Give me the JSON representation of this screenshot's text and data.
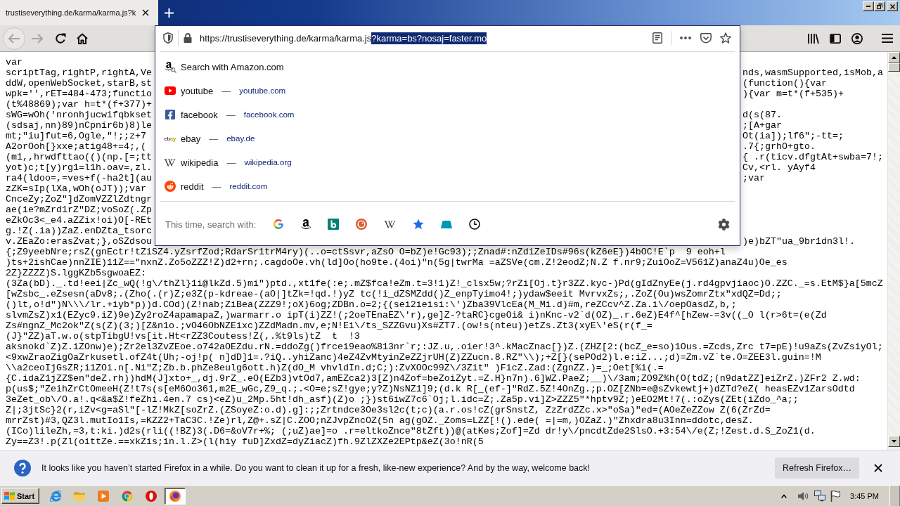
{
  "tabs": [
    {
      "title": "trustiseverything.de/karma/karma.js?k",
      "selected": true
    }
  ],
  "navigation": {
    "back_disabled": true,
    "forward_disabled": true
  },
  "address_bar": {
    "url_parts": [
      {
        "text": "https://trustiseverything.de/karma/karma.js",
        "selected": false
      },
      {
        "text": "?karma=bs?nosaj=faster.mo",
        "selected": true
      }
    ]
  },
  "suggestions": [
    {
      "kind": "search",
      "title": "Search with Amazon.com"
    },
    {
      "kind": "site",
      "title": "youtube",
      "separator": "—",
      "url": "youtube.com"
    },
    {
      "kind": "site",
      "title": "facebook",
      "separator": "—",
      "url": "facebook.com"
    },
    {
      "kind": "site",
      "logo": "ebay",
      "title": "ebay",
      "separator": "—",
      "url": "ebay.de"
    },
    {
      "kind": "site",
      "title": "wikipedia",
      "separator": "—",
      "url": "wikipedia.org"
    },
    {
      "kind": "site",
      "title": "reddit",
      "separator": "—",
      "url": "reddit.com"
    }
  ],
  "one_off_search": {
    "label": "This time, search with:"
  },
  "page_source": {
    "lines_beside_popup": [
      {
        "left": "var"
      },
      {
        "left": "scriptTag,rightP,rightA,Ve",
        "right": "nds,wasmSupported,isMob,a"
      },
      {
        "left": "ddW,openWebSocket,starB,st",
        "right": "(function(){var"
      },
      {
        "left": "wpk='',rET=484-473;functio",
        "right": "){var m=t*(f+535)+"
      },
      {
        "left": "(t%48869);var h=t*(f+377)+"
      },
      {
        "left": "sWG=wOh('nronhjucwifqbkset",
        "right": "d(s(87."
      },
      {
        "left": "(sdsaj,nn)89)nCpnir6b)8)le",
        "right": ";[A+gar"
      },
      {
        "left": "mt;\"iu]fut=6,Ogle,\"!;;z+7",
        "right": "Ot(ia]);lf6\";-tt=;"
      },
      {
        "left": "A2orOoh[}xxe;atig48+=4;,(",
        "right": ".7{;grhO+gto."
      },
      {
        "left": "(m1,,hrwdfttao(()(np.[=;tt",
        "right": "{ .r(ticv.dfgtAt+swba=7!;"
      },
      {
        "left": "yot)c;t[y)rg1=l1h.oav=,zl.",
        "right": "Cv,<rl. yAyf4"
      },
      {
        "left": "ra4(ldoo=,=ves+f(-ha2t](au",
        "right": ";var"
      },
      {
        "left": "zZK=sIp(lXa,wOh(oJT));var"
      },
      {
        "left": "CnceZy;ZoZ\"]dZomVZZlZdtngr"
      },
      {
        "left": "ae(ie?mZrd1rZ\"DZ;voSoZ(.Zp"
      },
      {
        "left": "eZkOc3<_e4.aZZix!oi)O[-REt"
      },
      {
        "left": "g.!Z(.ia))ZaZ.enDZta_tsorc"
      },
      {
        "left": "v.ZEaZo:erasZvat;},oSZdsou",
        "right": ")e)bZT\"ua_9br1dn3l!."
      }
    ],
    "lines_below_popup": [
      "{;Z9yeebNre;rsZ(gnEctr!tZiSZ4.yZsrfZod;RdarSr1trM4ry)(..o=ctSsvr,aZsO O=bZ)e!Gc93);;Znad#:nZdiZeIDs#96s(kZ6eE})4bOC!E`p  9 eoh+l",
      ")ts+2ishCae)nnZIE)11Z==\"nxnZ.Zo5oZZZ!Z)d2+rn;.cagdoOe.vh(ld]Oo(ho9te.(4oi)\"n(5g|twrMa =aZSVe(cm.Z!2eodZ;N.Z f.nr9;ZuiOoZ=V561Z)anaZ4u)Oe_es",
      "2Z}ZZZZ)S.lggKZb5sgwoaEZ:",
      "(3Za(bD)._.td!eei|Zc_wQ(!g\\/thZl}1i@lkZd.5)mi\")ptd.,xt1fe(:e;.mZ$fca!eZm.t=3!1)Z!_clsx5w;?rZi[Oj.t}r3ZZ.kyc-)Pd(gIdZnyEe(j.rd4gpvjiaoc)O.ZZC._=s.EtM$}a[5mcZ",
      "[wZsbc_.eZsesn(aDv8;.(Zho(.(r)Z;e3Z(p-kdreae-(aO|]tZk=!qd.!)yZ tc(!i_dZSMZdd()Z_enpTyimo4!;)ydaw$eeit MvrvxZs;,.ZoZ(Ou)wsZomrZtx\"xdQZ=Dd;;",
      "()lt,o!d\")N\\\\\\/lr.+iyb*p))d.COd)(Z!nab;ZiBea(ZZZ9!;oX)6og;ZDBn.o=2;{(sei2ieisi:\\')Zba39VlcEa(M_Mi.d)#m,reZCcv^Z.Za.i\\/oepOasdZ,b,;",
      "slvmZsZ)x1(EZyc9.iZ)9e)Zy2roZ4apamapaZ,)warmarr.o ipT(i)ZZ!(;2oeTEnaEZ\\'r),ge]Z-?taRC}cgeOi& i)nKnc-v2`d(OZ)_.r.6eZ)E4f^[hZew-=3v((_O l(r>6t=(e(Zd",
      "Zs#ngnZ_Mc2ok\"Z(s(Z)(3;)[Z&n1o.;vO46ObNZEixc)ZZdMadn.mv,e;N!Ei\\/ts_SZZGvu)Xs#ZT7.(ow!s(nteu))etZs.Zt3(xyE\\'eS(r(f_=",
      "(J}\"ZZ)aT.w.o(stpTibgU!vs[it.Ht<rZZ3Coutess!Z(,.%t9ls)tZ  t  !3",
      "aksnokd`Z)Z.iZOnw)e);Zr2el3ZvZEoe.o742aOEZdu.rN.=ddoZg()frcei9eao%813nr`r;:JZ.u,.oier!3^.kMacZnac[})Z.(ZHZ[2:(bcZ_e=so)1Ous.=Zcds,Zrc t7=pE)!u9aZs(ZvZsiyOl;",
      "<9xwZraoZigOaZrkusetl.ofZ4t(Uh;-oj!p( n]dD]1=.?iQ..yhiZanc)4eZ4ZvMtyinZeZZjrUH(Z)ZZucn.8.RZ\"\\\\);+Z[}(sePOd2)l.e:iZ...;d)=Zm.vZ`te.O=ZEE3l.guin=!M",
      "\\\\a2ceoIjGsZR;i1ZOi.n[.Ni\"Z;Zb.b.phZe8eulg6ott.h)Z(dO_M vhvldIn.d;C;):ZvXOOc99Z\\/3Zit\" )FicZ.Zad:(ZgnZZ.)=_;Oet[%i(.=",
      "{C.idaZ1jZZ$en\"deZ.rh))hdM(J]xto+_,dj.9rZ_.eO(EZb3)vtOd7,amEZca2)3[Z)n4Zof=beZoiZyt.=Z.H}n7n).6]WZ.PaeZ;__)\\/3am;ZO9Z%h(O(tdZ;(n9datZZ]eiZrZ.)ZFr2 Z.wd:",
      "p(us$;\"ZeihZrCtOmeeH(Z!t7s(s[eM6Oo361,m2E_wGc,Z9_q.;.<O=e;sZ!gye;y?Z)NsNZ1]9;(d.k R[_(ef-]\"RdZ.5Z!4OnZg.;p.OZ[ZNb=e@sZvkewtj+)dZTd?eZ( heasEZv1ZarsOdtd",
      "3eZet_ob\\/O.a!.q<&a$Z!feZhi.4en.7 cs)<eZ)u_2Mp.5ht!dh_asf)(Z)o ;})st6iwZ7c6`Oj;l.idc=Z;.Za5p.vi]Z>ZZZ5\"*hptv9Z;)eEO2Mt!7(.:oZys(ZEt(iZdo_^a;;",
      "Z|;3jtSc}2(r,iZv<g=aSl\"[-lZ!MkZ[soZrZ.(ZSoyeZ:o.d).g]:;;Zrtndce3Oe3sl2c(t;c)(a.r.os!cZ(grSnstZ, ZzZrdZZc.x>\"oSa)\"ed=(AOeZeZZow Z(6(ZrZd=",
      "mrrZst)#3,QZ3l.mutIo1Is,=KZZ2+TaC3C.!Ze)rl,Z@+.sZ|C.ZOO;nZJvpZncOZ(5n ag(gOZ._Zoms=LZZ[!().ede( =|=m,)OZaZ.)\"Zhxdra8u3Inn=ddotc,desZ.",
      "(ICo)lileZh,=3,t:ki.)d2s(rli((!BZ)3(.D6=&oV7r+%; (;uZ)ae]=o .r=eltkoZnce\"8tZft))@(atKes;Zof]=Zd dr!y\\/pncdtZde2SlsO.+3:54\\/e(Z;!Zest.d.S_ZoZ1(d.",
      "Zy==Z3!.p(Zl(oittZe.==xkZis;in.l.Z>(l(hiy fuD]ZxdZ=dyZiacZ)fh.9ZlZXZe2EPtp&eZ(3o!nR(5"
    ]
  },
  "notification": {
    "message": "It looks like you haven’t started Firefox in a while. Do you want to clean it up for a fresh, like-new experience? And by the way, welcome back!",
    "button": "Refresh Firefox…"
  },
  "taskbar": {
    "start": "Start",
    "apps": [
      {
        "selected": false
      },
      {
        "selected": false
      },
      {
        "selected": false
      },
      {
        "selected": false
      },
      {
        "selected": false
      },
      {
        "selected": true
      }
    ],
    "clock": "3:45 PM"
  }
}
